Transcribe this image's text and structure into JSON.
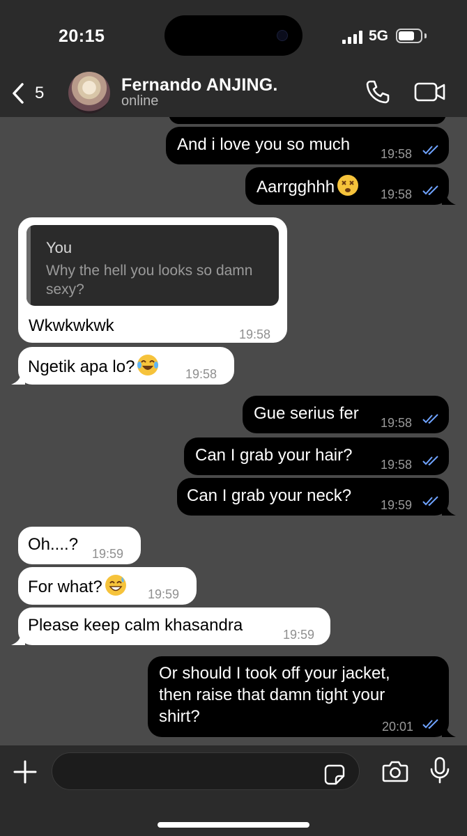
{
  "status_bar": {
    "time": "20:15",
    "network": "5G"
  },
  "header": {
    "back_count": "5",
    "contact_name": "Fernando ANJING.",
    "contact_status": "online"
  },
  "messages": [
    {
      "direction": "out",
      "text": "And i love you so much",
      "time": "19:58"
    },
    {
      "direction": "out",
      "text": "Aarrgghhh",
      "emoji": "face-with-crossed-out-eyes",
      "time": "19:58"
    },
    {
      "direction": "in",
      "reply_to": {
        "author": "You",
        "text": "Why the hell you looks so damn sexy?"
      },
      "text": "Wkwkwkwk",
      "time": "19:58"
    },
    {
      "direction": "in",
      "text": "Ngetik apa lo?",
      "emoji": "face-with-tears-of-joy",
      "time": "19:58"
    },
    {
      "direction": "out",
      "text": "Gue serius fer",
      "time": "19:58"
    },
    {
      "direction": "out",
      "text": "Can I grab your hair?",
      "time": "19:58"
    },
    {
      "direction": "out",
      "text": "Can I grab your neck?",
      "time": "19:59"
    },
    {
      "direction": "in",
      "text": "Oh....?",
      "time": "19:59"
    },
    {
      "direction": "in",
      "text": "For what?",
      "emoji": "grinning-face-with-sweat",
      "time": "19:59"
    },
    {
      "direction": "in",
      "text": "Please keep calm khasandra",
      "time": "19:59"
    },
    {
      "direction": "out",
      "lines": [
        "Or should I took off your jacket,",
        "then raise that damn tight your",
        "shirt?"
      ],
      "time": "20:01"
    }
  ],
  "input": {
    "placeholder": ""
  },
  "colors": {
    "chat_background": "#4a4a4a",
    "bar_background": "#2b2b2b",
    "outgoing_bubble": "#000000",
    "incoming_bubble": "#ffffff",
    "read_ticks": "#6fa3ff"
  }
}
